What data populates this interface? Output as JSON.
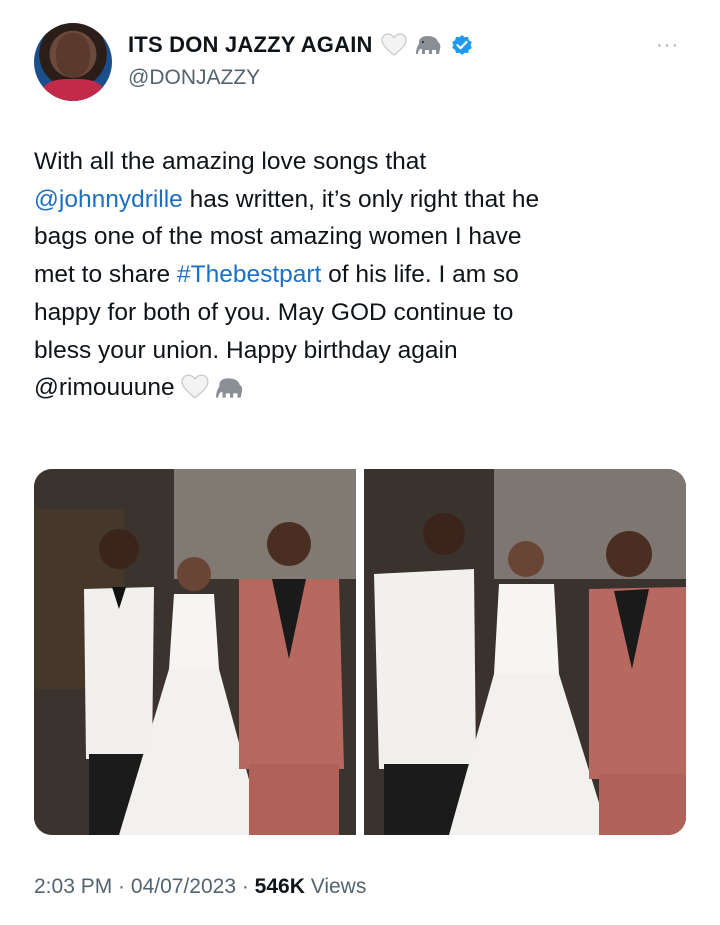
{
  "header": {
    "display_name": "ITS DON JAZZY AGAIN",
    "handle": "@DONJAZZY",
    "more": "···",
    "colors": {
      "verified": "#1d9bf0",
      "link": "#1d6fc2"
    }
  },
  "tweet": {
    "lines": [
      {
        "pre": "With all the amazing love songs that",
        "link": "",
        "post": ""
      },
      {
        "pre": "",
        "link": "@johnnydrille",
        "post": " has written, it’s only right that he"
      },
      {
        "pre": "bags one of the most amazing women I have",
        "link": "",
        "post": ""
      },
      {
        "pre": "met to share ",
        "link": "#Thebestpart",
        "post": " of his life. I am so"
      },
      {
        "pre": "happy for both of you. May GOD continue to",
        "link": "",
        "post": ""
      },
      {
        "pre": "bless your union. Happy birthday again",
        "link": "",
        "post": ""
      },
      {
        "pre": "@rimouuune",
        "link": "",
        "post": ""
      }
    ]
  },
  "photos": [
    {
      "name": "wedding-photo-left"
    },
    {
      "name": "wedding-photo-right"
    }
  ],
  "meta": {
    "time": "2:03 PM",
    "sep1": " · ",
    "date": "04/07/2023",
    "sep2": " · ",
    "views_count": "546K",
    "views_label": " Views"
  }
}
